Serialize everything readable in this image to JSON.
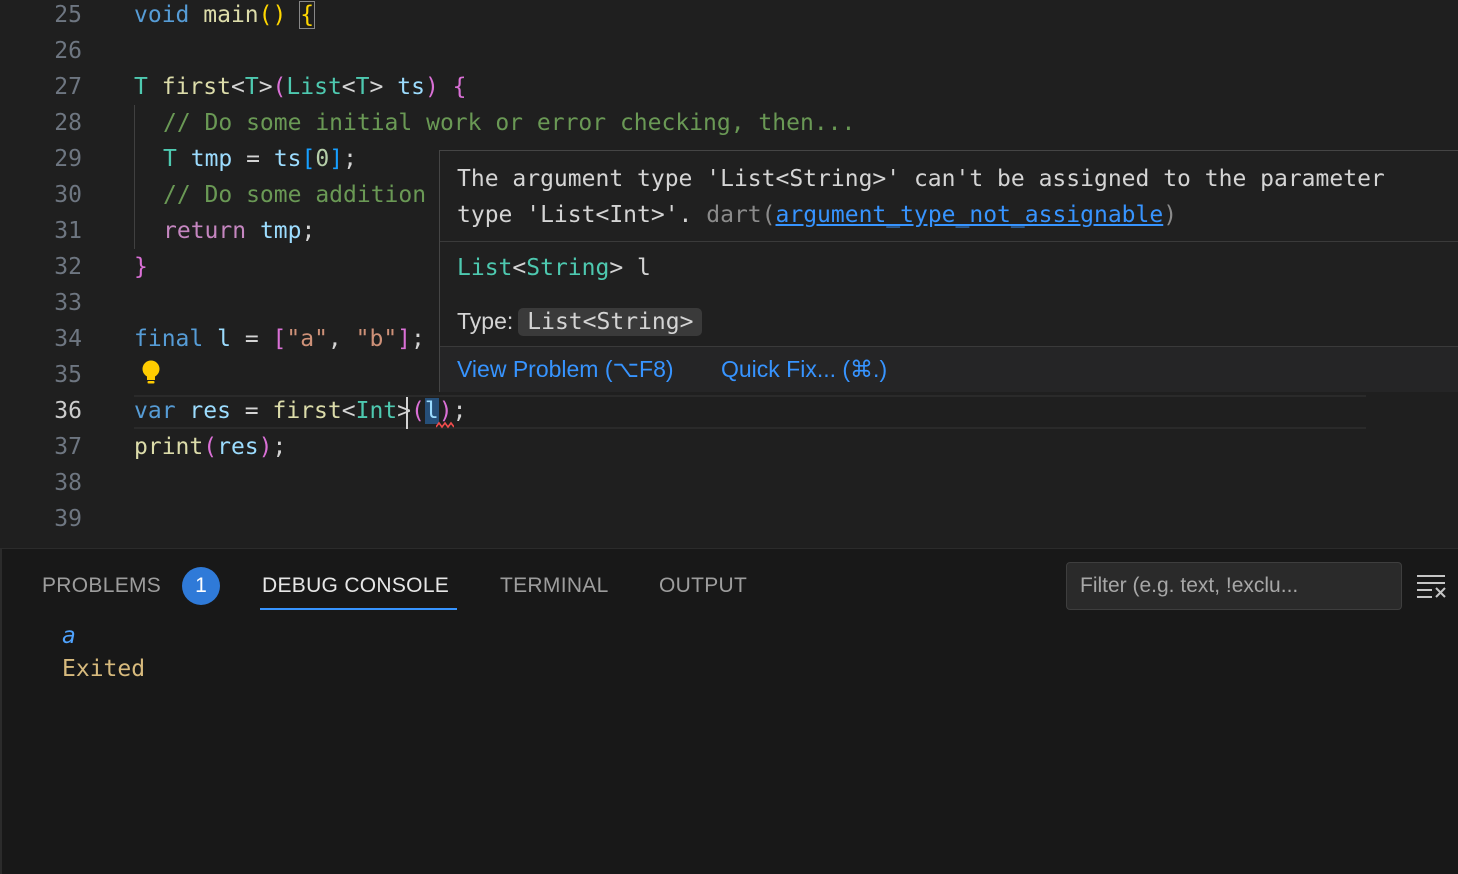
{
  "editor": {
    "active_line": "36",
    "line_numbers": [
      "25",
      "26",
      "27",
      "28",
      "29",
      "30",
      "31",
      "32",
      "33",
      "34",
      "35",
      "36",
      "37",
      "38",
      "39"
    ],
    "lines": {
      "l25": {
        "kw": "void",
        "fn": "main",
        "paren": "()",
        "brace": "{"
      },
      "l27": {
        "t": "T",
        "fn": "first",
        "lt": "<",
        "gt": ">",
        "p1": "(",
        "list": "List",
        "ts": "ts",
        "p2": ")",
        "brace": "{"
      },
      "l28": {
        "comment": "// Do some initial work or error checking, then..."
      },
      "l29": {
        "t": "T",
        "tmp": "tmp",
        "eq": " = ",
        "ts": "ts",
        "lb": "[",
        "zero": "0",
        "rb": "]",
        "semi": ";"
      },
      "l30": {
        "comment": "// Do some addition"
      },
      "l31": {
        "ret": "return",
        "tmp": "tmp",
        "semi": ";"
      },
      "l32": {
        "brace": "}"
      },
      "l34": {
        "kw": "final",
        "var": "l",
        "eq": " = ",
        "lb": "[",
        "a": "\"a\"",
        "comma": ", ",
        "b": "\"b\"",
        "rb": "]",
        "semi": ";"
      },
      "l36": {
        "kw": "var",
        "res": "res",
        "eq": " = ",
        "fn": "first",
        "lt": "<",
        "int": "Int",
        "gt": ">",
        "p1": "(",
        "arg": "l",
        "p2": ")",
        "semi": ";"
      },
      "l37": {
        "fn": "print",
        "p1": "(",
        "res": "res",
        "p2": ")",
        "semi": ";"
      }
    }
  },
  "hover": {
    "message_line1": "The argument type 'List<String>' can't be assigned to the parameter",
    "message_line2_prefix": "type 'List<Int>'. ",
    "source": "dart(",
    "code_link": "argument_type_not_assignable",
    "source_close": ")",
    "signature_type": "List",
    "signature_lt": "<",
    "signature_inner": "String",
    "signature_rest": "> l",
    "type_label": "Type:",
    "type_value": "List<String>",
    "action_view_problem": "View Problem (⌥F8)",
    "action_quick_fix": "Quick Fix... (⌘.)"
  },
  "panel": {
    "tabs": [
      {
        "label": "PROBLEMS",
        "badge": "1"
      },
      {
        "label": "DEBUG CONSOLE"
      },
      {
        "label": "TERMINAL"
      },
      {
        "label": "OUTPUT"
      }
    ],
    "filter_placeholder": "Filter (e.g. text, !exclu...",
    "output": [
      "a",
      "Exited"
    ]
  },
  "colors": {
    "keyword": "#569cd6",
    "type": "#4ec9b0",
    "function": "#dcdcaa",
    "comment": "#6a9955",
    "string": "#ce9178",
    "link": "#3794ff",
    "badge": "#2f7ad8",
    "exited": "#d7ba7d"
  },
  "icons": [
    "lightbulb-icon",
    "error-squiggle-icon",
    "clear-console-icon"
  ]
}
